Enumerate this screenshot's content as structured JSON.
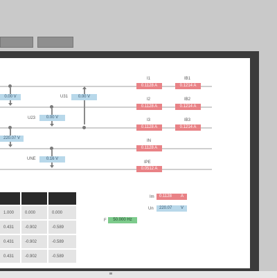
{
  "tabs": [
    {
      "label": ""
    },
    {
      "label": ""
    }
  ],
  "voltage_lines": [
    {
      "label": "",
      "value": "0.00 V"
    },
    {
      "label": "U31",
      "value": "0.00 V"
    },
    {
      "label": "U23",
      "value": "0.00 V"
    },
    {
      "label": "",
      "value": "220.07 V"
    },
    {
      "label": "UNE",
      "value": "0.16 V"
    }
  ],
  "currents": [
    {
      "label": "I1",
      "value": "0.1128 A"
    },
    {
      "label": "IB1",
      "value": "0.1214 A"
    },
    {
      "label": "I2",
      "value": "0.1128 A"
    },
    {
      "label": "IB2",
      "value": "0.1214 A"
    },
    {
      "label": "I3",
      "value": "0.1128 A"
    },
    {
      "label": "IB3",
      "value": "0.1214 A"
    },
    {
      "label": "IN",
      "value": "0.1128 A"
    },
    {
      "label": "IPE",
      "value": "0.0512 A"
    }
  ],
  "table": {
    "headers": [
      "",
      "",
      ""
    ],
    "rows": [
      [
        "1.000",
        "0.000",
        "0.000"
      ],
      [
        "0.431",
        "-0.902",
        "-0.589"
      ],
      [
        "0.431",
        "-0.902",
        "-0.589"
      ],
      [
        "0.431",
        "-0.902",
        "-0.589"
      ]
    ]
  },
  "summary": {
    "im_label": "Im",
    "im_value": "0.1128",
    "im_unit": "A",
    "un_label": "Un",
    "un_value": "220.07",
    "un_unit": "V",
    "f_label": "F",
    "f_value": "50.000 Hz"
  },
  "colors": {
    "current_red": "#e98286",
    "voltage_blue": "#b8d8ea",
    "frequency_green": "#7dcb8c",
    "frame_dark": "#3b3b3b"
  }
}
